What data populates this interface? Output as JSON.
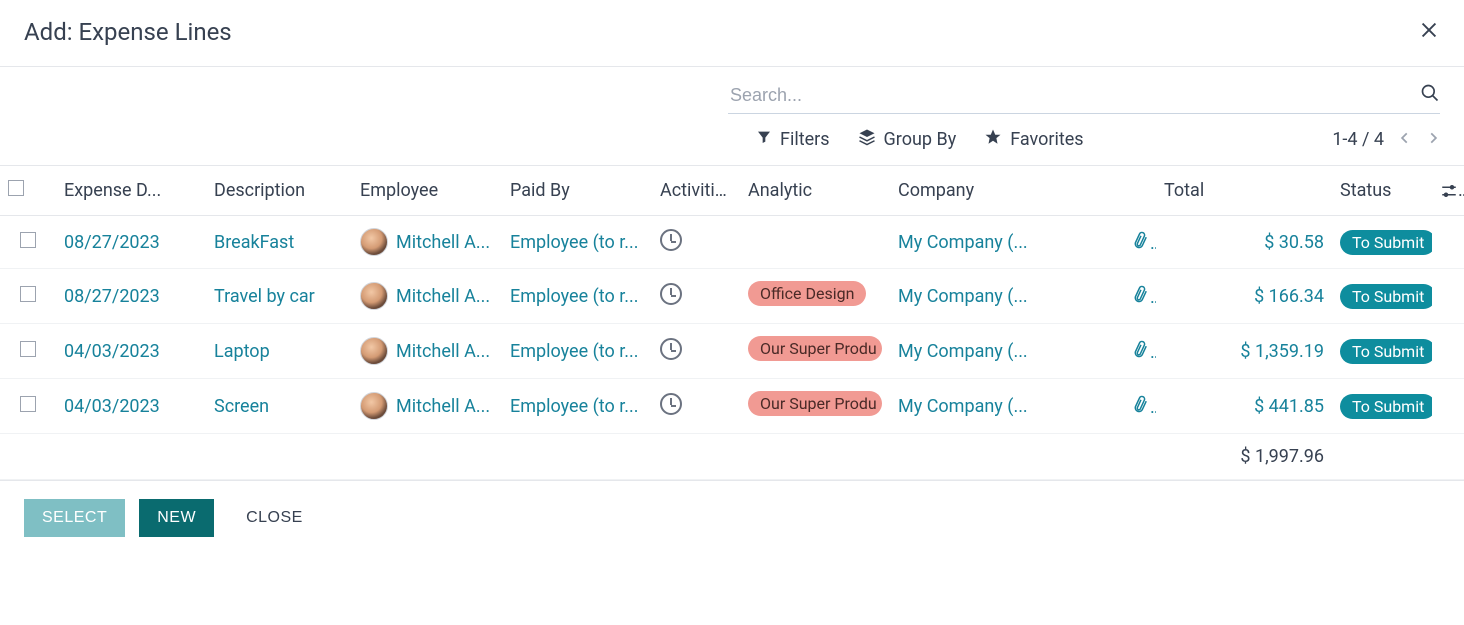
{
  "modal": {
    "title": "Add: Expense Lines"
  },
  "search": {
    "placeholder": "Search..."
  },
  "toolbar": {
    "filters": "Filters",
    "groupby": "Group By",
    "favorites": "Favorites",
    "pager": "1-4 / 4"
  },
  "columns": {
    "date": "Expense D...",
    "description": "Description",
    "employee": "Employee",
    "paidby": "Paid By",
    "activities": "Activities",
    "analytic": "Analytic",
    "company": "Company",
    "total": "Total",
    "status": "Status"
  },
  "rows": [
    {
      "date": "08/27/2023",
      "description": "BreakFast",
      "employee": "Mitchell A...",
      "paidby": "Employee (to r...",
      "analytic": "",
      "company": "My Company (...",
      "total": "$ 30.58",
      "status": "To Submit"
    },
    {
      "date": "08/27/2023",
      "description": "Travel by car",
      "employee": "Mitchell A...",
      "paidby": "Employee (to r...",
      "analytic": "Office Design",
      "company": "My Company (...",
      "total": "$ 166.34",
      "status": "To Submit"
    },
    {
      "date": "04/03/2023",
      "description": "Laptop",
      "employee": "Mitchell A...",
      "paidby": "Employee (to r...",
      "analytic": "Our Super Produ",
      "company": "My Company (...",
      "total": "$ 1,359.19",
      "status": "To Submit"
    },
    {
      "date": "04/03/2023",
      "description": "Screen",
      "employee": "Mitchell A...",
      "paidby": "Employee (to r...",
      "analytic": "Our Super Produ",
      "company": "My Company (...",
      "total": "$ 441.85",
      "status": "To Submit"
    }
  ],
  "grand_total": "$ 1,997.96",
  "footer": {
    "select": "SELECT",
    "new": "NEW",
    "close": "CLOSE"
  }
}
